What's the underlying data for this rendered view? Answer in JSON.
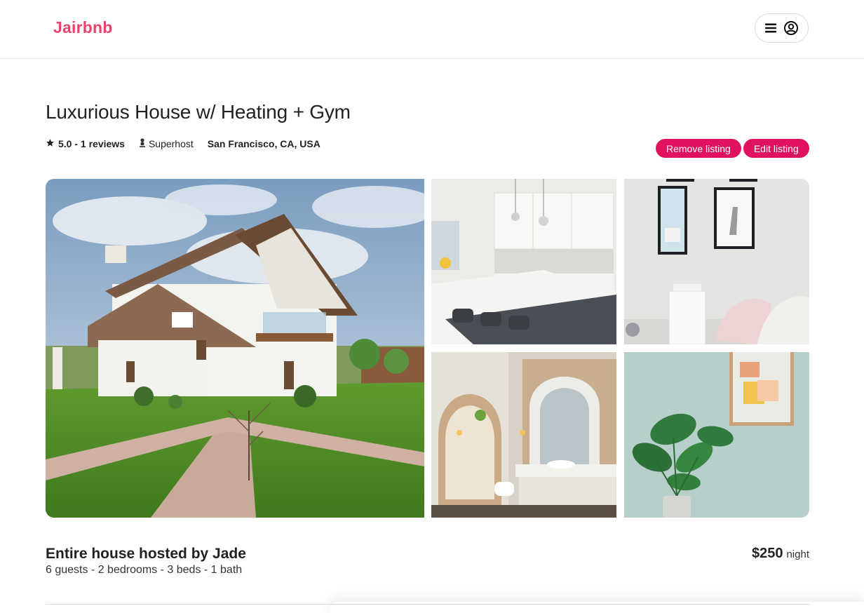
{
  "nav": {
    "logo": "Jairbnb",
    "menu_icon": "hamburger-icon",
    "account_icon": "user-circle-icon",
    "brand_color": "#e8446d"
  },
  "listing": {
    "title": "Luxurious House w/ Heating + Gym",
    "rating": "5.0 - 1 reviews",
    "rating_icon": "star-icon",
    "superhost": "Superhost",
    "superhost_icon": "person-icon",
    "location": "San Francisco, CA, USA",
    "hosted_by": "Entire house hosted by Jade",
    "details": "6 guests - 2 bedrooms - 3 beds - 1 bath",
    "price": "$250",
    "price_unit": "night"
  },
  "actions": {
    "remove_label": "Remove listing",
    "edit_label": "Edit listing",
    "button_color": "#e0115f"
  },
  "photos": [
    {
      "name": "house-exterior"
    },
    {
      "name": "kitchen"
    },
    {
      "name": "living-room"
    },
    {
      "name": "bathroom"
    },
    {
      "name": "plant-wall"
    }
  ]
}
